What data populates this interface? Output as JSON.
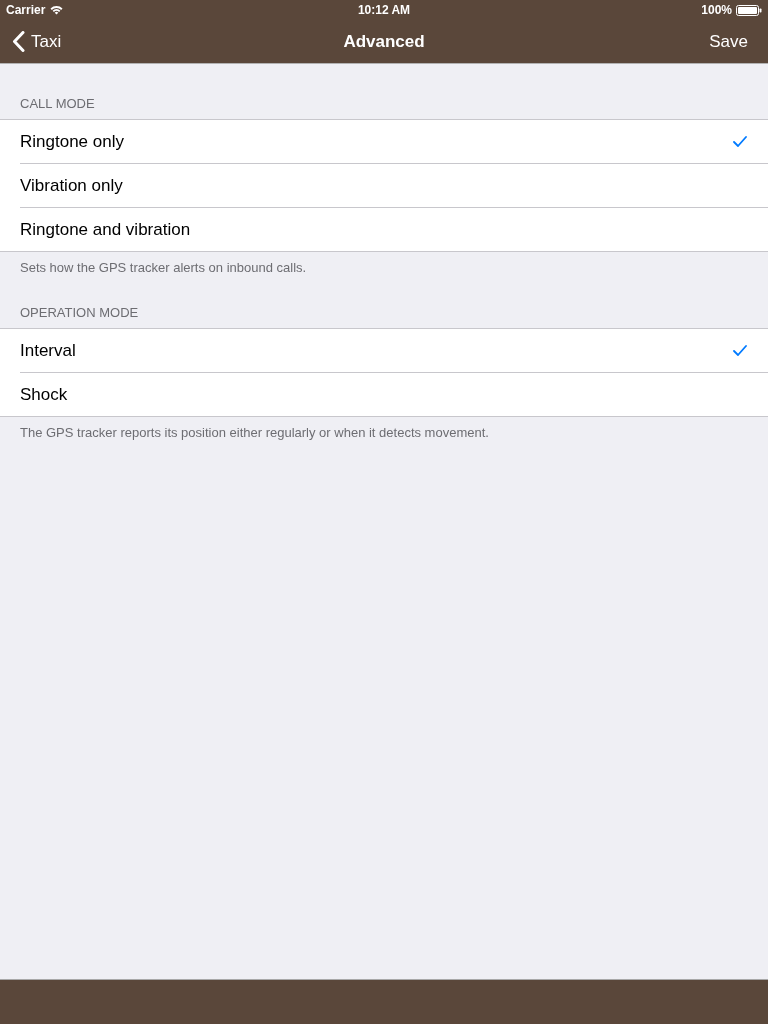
{
  "status_bar": {
    "carrier": "Carrier",
    "time": "10:12 AM",
    "battery": "100%"
  },
  "nav_bar": {
    "back": "Taxi",
    "title": "Advanced",
    "action": "Save"
  },
  "sections": [
    {
      "header": "CALL MODE",
      "options": [
        {
          "label": "Ringtone only",
          "selected": true
        },
        {
          "label": "Vibration only",
          "selected": false
        },
        {
          "label": "Ringtone and vibration",
          "selected": false
        }
      ],
      "footer": "Sets how the GPS tracker alerts on inbound calls."
    },
    {
      "header": "OPERATION MODE",
      "options": [
        {
          "label": "Interval",
          "selected": true
        },
        {
          "label": "Shock",
          "selected": false
        }
      ],
      "footer": "The GPS tracker reports its position either regularly or when it detects movement."
    }
  ]
}
